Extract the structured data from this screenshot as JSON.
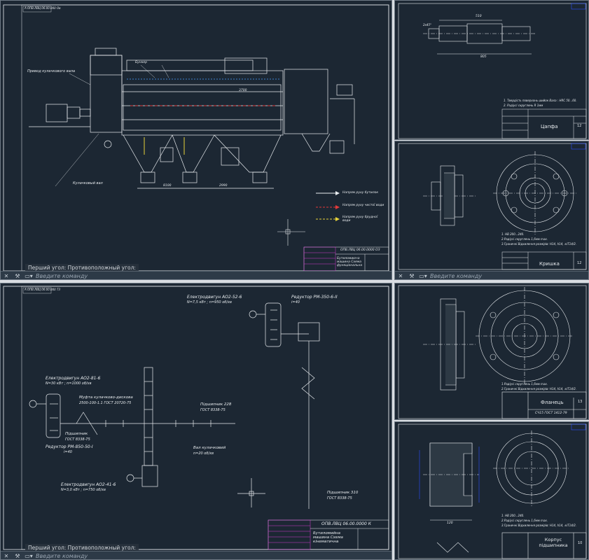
{
  "colors": {
    "viewport_bg": "#1c2733",
    "line": "#e8ecef",
    "accent_red": "#e23a3a",
    "accent_yellow": "#e6d23a",
    "accent_magenta": "#d23ad2",
    "accent_blue": "#2a4fff"
  },
  "viewports": {
    "top_left": {
      "header": "А ОПВ.ЛВЦ 06.00.000 Ов",
      "labels": {
        "drive": "Привод кулачкового вала",
        "camshaft": "Кулачковый вал",
        "bunker": "Бункер",
        "dim1": "3700",
        "dim2": "8100",
        "dim3": "2990",
        "legend1": "Напрям руху бутилок",
        "legend2": "Напрям руху чистої води",
        "legend3": "Напрям руху брудної води"
      },
      "title_block": {
        "code": "ОПВ.ЛВЦ 06.00.0000 ОЗ",
        "name": "Бутиломиюча машина Схема функціональна"
      },
      "history": "Перший угол: Противоположный угол:",
      "command_placeholder": "Введите команду"
    },
    "top_right": {
      "dims": {
        "d1": "510",
        "d2": "805",
        "d3": "2х45°"
      },
      "notes": [
        "1. Твердість поверхонь шийок Вала : HRC 50...60.",
        "2. Радіусі скруглень R 1мм"
      ],
      "title": "Цапфа",
      "sheet": "12"
    },
    "mid_right": {
      "notes": [
        "1. HB 200...240.",
        "2.Радіусі скруглень 1,6мм max.",
        "3.Граничні Відхилення розмірів: H14, h14, ±IT14/2."
      ],
      "title": "Кришка",
      "sheet": "12",
      "command_placeholder": "Введите команду"
    },
    "bottom_left": {
      "header": "А ОПВ.ЛВЦ 06.00.000 ТЗ",
      "labels": {
        "motor1": "Електродвигун АО2-52-6",
        "motor1_spec": "N=7,5 кВт ; n=950 об/хв",
        "reducer1": "Редуктор РМ-350-6-II",
        "reducer1_ratio": "i=40",
        "motor2": "Електродвигун АО2-81-6",
        "motor2_spec": "N=30 кВт ; n=1000 об/хв",
        "coupling": "Муфта кулачково-дискова",
        "coupling_std": "2500-100-1.1 ГОСТ 20720-75",
        "bearing1": "Підшипник",
        "bearing1_std": "ГОСТ 8338-75",
        "reducer2": "Редуктор РМ-850-50-I",
        "reducer2_ratio": "i=40",
        "bearing2": "Підшипник 228",
        "bearing2_std": "ГОСТ 8338-75",
        "camshaft": "Вал кулачковий",
        "camshaft_speed": "n=20 об/хв",
        "motor3": "Електродвигун АО2-41-6",
        "motor3_spec": "N=3,0 кВт ; n=750 об/хв",
        "bearing3": "Підшипник 310",
        "bearing3_std": "ГОСТ 8338-75"
      },
      "title_block": {
        "code": "ОПВ.ЛВЦ 06.00.0000 К",
        "name": "Бутиломийна машина Схема кінематична"
      },
      "history": "Перший угол: Противоположный угол:",
      "command_placeholder": "Введите команду"
    },
    "bottom_right1": {
      "notes": [
        "1.Радіусі скруглень 1,6мм max.",
        "2.Граничні Відхилення розмірів: H14, h14, ±IT14/2."
      ],
      "title": "Фланець",
      "sheet": "13",
      "material": "СЧ15 ГОСТ 1412-79"
    },
    "bottom_right2": {
      "notes": [
        "1. HB 200...240.",
        "2.Радіусі скруглень 1,6мм max.",
        "3.Граничні Відхилення розмірів: H14, h14, ±IT14/2."
      ],
      "title": "Корпус підшипника",
      "sheet": "10",
      "dim": "120"
    }
  }
}
